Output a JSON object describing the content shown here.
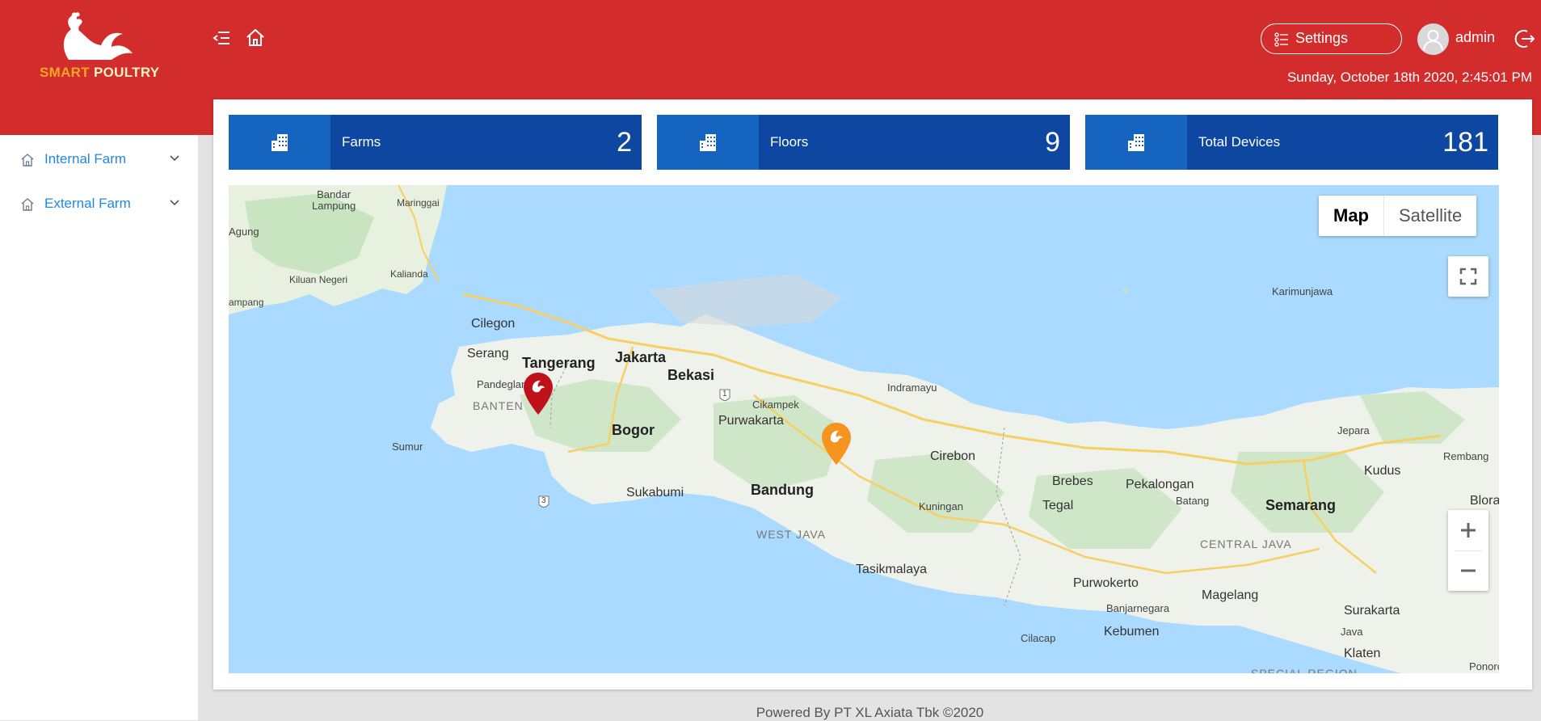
{
  "brand": {
    "word1": "SMART",
    "word2": "POULTRY"
  },
  "header": {
    "settings_label": "Settings",
    "username": "admin",
    "datetime": "Sunday, October 18th 2020, 2:45:01 PM"
  },
  "sidebar": {
    "items": [
      {
        "label": "Internal Farm"
      },
      {
        "label": "External Farm"
      }
    ]
  },
  "stats": [
    {
      "label": "Farms",
      "value": "2"
    },
    {
      "label": "Floors",
      "value": "9"
    },
    {
      "label": "Total Devices",
      "value": "181"
    }
  ],
  "map": {
    "type_options": [
      "Map",
      "Satellite"
    ],
    "selected_type": "Map",
    "places": {
      "bandar_lampung": "Bandar\nLampung",
      "maringgai": "Maringgai",
      "agung": "Agung",
      "kalianda": "Kalianda",
      "kiluan_negeri": "Kiluan Negeri",
      "ampang": "ampang",
      "cilegon": "Cilegon",
      "serang": "Serang",
      "tangerang": "Tangerang",
      "jakarta": "Jakarta",
      "bekasi": "Bekasi",
      "pandeglang": "Pandeglang",
      "banten": "BANTEN",
      "bogor": "Bogor",
      "cikampek": "Cikampek",
      "purwakarta": "Purwakarta",
      "indramayu": "Indramayu",
      "sumur": "Sumur",
      "sukabumi": "Sukabumi",
      "bandung": "Bandung",
      "cirebon": "Cirebon",
      "brebes": "Brebes",
      "tegal": "Tegal",
      "pekalongan": "Pekalongan",
      "batang": "Batang",
      "semarang": "Semarang",
      "kuningan": "Kuningan",
      "west_java": "WEST JAVA",
      "central_java": "CENTRAL JAVA",
      "tasikmalaya": "Tasikmalaya",
      "purwokerto": "Purwokerto",
      "banjarnegara": "Banjarnegara",
      "magelang": "Magelang",
      "surakarta": "Surakarta",
      "kebumen": "Kebumen",
      "cilacap": "Cilacap",
      "jepara": "Jepara",
      "kudus": "Kudus",
      "rembang": "Rembang",
      "blora": "Blora",
      "karimunjawa": "Karimunjawa",
      "klaten": "Klaten",
      "java": "Java",
      "ponoro": "Ponoro",
      "special_region": "SPECIAL REGION"
    },
    "road_shields": [
      "1",
      "3"
    ],
    "markers": [
      {
        "color": "#c0111b"
      },
      {
        "color": "#f5941f"
      }
    ]
  },
  "footer": {
    "text": "Powered By PT XL Axiata Tbk ©2020"
  },
  "colors": {
    "header_red": "#d32c2c",
    "stat_blue": "#0d47a1",
    "stat_icon_blue": "#1565c0",
    "link_blue": "#1e88e5",
    "water": "#aadaff"
  }
}
